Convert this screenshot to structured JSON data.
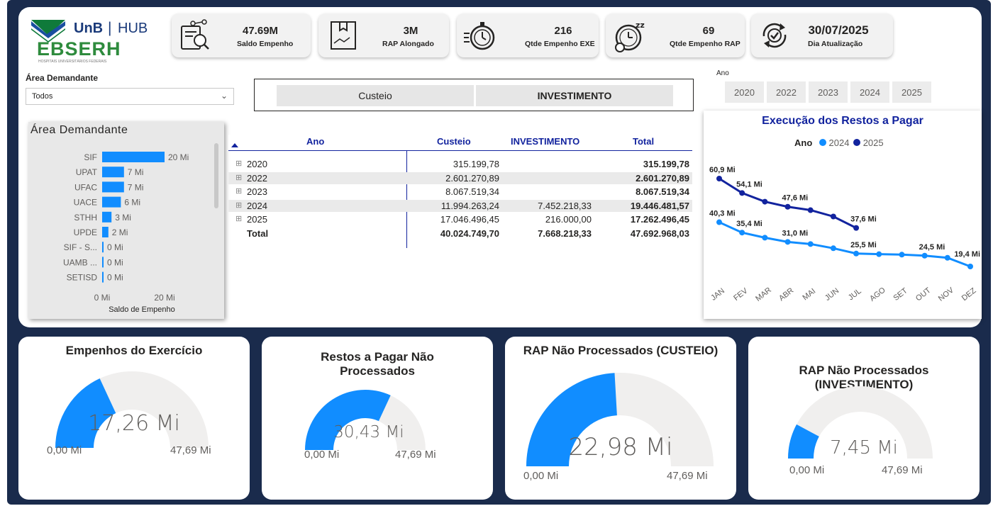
{
  "brand": {
    "name_1": "UnB",
    "separator": "|",
    "name_2": "HUB",
    "org": "EBSERH",
    "org_sub": "HOSPITAIS UNIVERSITÁRIOS FEDERAIS"
  },
  "kpis": [
    {
      "value": "47.69M",
      "label": "Saldo Empenho",
      "icon": "budget-document-icon"
    },
    {
      "value": "3M",
      "label": "RAP Alongado",
      "icon": "box-icon"
    },
    {
      "value": "216",
      "label": "Qtde Empenho EXE",
      "icon": "stopwatch-icon"
    },
    {
      "value": "69",
      "label": "Qtde Empenho RAP",
      "icon": "clock-sleep-icon"
    },
    {
      "value": "30/07/2025",
      "label": "Dia Atualização",
      "icon": "refresh-check-icon"
    }
  ],
  "area_slicer": {
    "title": "Área Demandante",
    "selected": "Todos"
  },
  "type_tiles": [
    "Custeio",
    "INVESTIMENTO"
  ],
  "year_slicer": {
    "title": "Ano",
    "years": [
      "2020",
      "2022",
      "2023",
      "2024",
      "2025"
    ]
  },
  "bar_chart": {
    "title": "Área Demandante",
    "xlabel": "Saldo de Empenho",
    "x_ticks": [
      "0 Mi",
      "20 Mi"
    ]
  },
  "matrix": {
    "headers": [
      "Ano",
      "Custeio",
      "INVESTIMENTO",
      "Total"
    ],
    "rows": [
      {
        "ano": "2020",
        "custeio": "315.199,78",
        "invest": "",
        "total": "315.199,78"
      },
      {
        "ano": "2022",
        "custeio": "2.601.270,89",
        "invest": "",
        "total": "2.601.270,89"
      },
      {
        "ano": "2023",
        "custeio": "8.067.519,34",
        "invest": "",
        "total": "8.067.519,34"
      },
      {
        "ano": "2024",
        "custeio": "11.994.263,24",
        "invest": "7.452.218,33",
        "total": "19.446.481,57"
      },
      {
        "ano": "2025",
        "custeio": "17.046.496,45",
        "invest": "216.000,00",
        "total": "17.262.496,45"
      }
    ],
    "total_row": {
      "label": "Total",
      "custeio": "40.024.749,70",
      "invest": "7.668.218,33",
      "total": "47.692.968,03"
    }
  },
  "line_chart": {
    "title": "Execução dos Restos a Pagar",
    "legend_title": "Ano",
    "month_labels": [
      "JAN",
      "FEV",
      "MAR",
      "ABR",
      "MAI",
      "JUN",
      "JUL",
      "AGO",
      "SET",
      "OUT",
      "NOV",
      "DEZ"
    ]
  },
  "gauges": [
    {
      "title": "Empenhos do Exercício",
      "value_label": "17,26 Mi",
      "min": "0,00 Mi",
      "max": "47,69 Mi",
      "value": 17.26,
      "max_value": 47.69
    },
    {
      "title": "Restos a Pagar Não Processados",
      "value_label": "30,43 Mi",
      "min": "0,00 Mi",
      "max": "47,69 Mi",
      "value": 30.43,
      "max_value": 47.69
    },
    {
      "title": "RAP Não Processados (CUSTEIO)",
      "value_label": "22,98 Mi",
      "min": "0,00 Mi",
      "max": "47,69 Mi",
      "value": 22.98,
      "max_value": 47.69
    },
    {
      "title": "RAP Não Processados (INVESTIMENTO)",
      "value_label": "7,45 Mi",
      "min": "0,00 Mi",
      "max": "47,69 Mi",
      "value": 7.45,
      "max_value": 47.69
    }
  ],
  "colors": {
    "accent": "#118dff",
    "dark_series": "#12239e",
    "frame": "#1a2b4c",
    "gauge_track": "#f0efee"
  },
  "chart_data": [
    {
      "type": "bar",
      "orientation": "horizontal",
      "title": "Área Demandante",
      "xlabel": "Saldo de Empenho",
      "ylabel": "",
      "categories": [
        "SIF",
        "UPAT",
        "UFAC",
        "UACE",
        "STHH",
        "UPDE",
        "SIF - S...",
        "UAMB ...",
        "SETISD"
      ],
      "values": [
        20,
        7,
        7,
        6,
        3,
        2,
        0,
        0,
        0
      ],
      "data_labels": [
        "20 Mi",
        "7 Mi",
        "7 Mi",
        "6 Mi",
        "3 Mi",
        "2 Mi",
        "0 Mi",
        "0 Mi",
        "0 Mi"
      ],
      "xlim": [
        0,
        20
      ],
      "color": "#118dff"
    },
    {
      "type": "line",
      "title": "Execução dos Restos a Pagar",
      "xlabel": "",
      "ylabel": "",
      "categories": [
        "JAN",
        "FEV",
        "MAR",
        "ABR",
        "MAI",
        "JUN",
        "JUL",
        "AGO",
        "SET",
        "OUT",
        "NOV",
        "DEZ"
      ],
      "legend": {
        "title": "Ano",
        "position": "top"
      },
      "series": [
        {
          "name": "2024",
          "color": "#118dff",
          "values": [
            40.3,
            35.4,
            33.0,
            31.0,
            30.0,
            28.0,
            25.5,
            25.2,
            25.0,
            24.5,
            23.5,
            19.4
          ],
          "labels": [
            "40,3 Mi",
            "35,4 Mi",
            "",
            "31,0 Mi",
            "",
            "",
            "25,5 Mi",
            "",
            "",
            "24,5 Mi",
            "",
            "19,4 Mi"
          ]
        },
        {
          "name": "2025",
          "color": "#12239e",
          "values": [
            60.9,
            54.1,
            50.0,
            47.6,
            46.0,
            43.0,
            37.6,
            null,
            null,
            null,
            null,
            null
          ],
          "labels": [
            "60,9 Mi",
            "54,1 Mi",
            "",
            "47,6 Mi",
            "",
            "",
            "37,6 Mi",
            "",
            "",
            "",
            "",
            ""
          ]
        }
      ]
    }
  ]
}
